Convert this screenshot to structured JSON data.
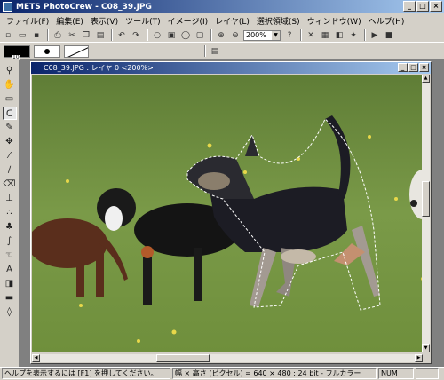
{
  "app": {
    "title": "METS PhotoCrew - C08_39.JPG"
  },
  "window_buttons": {
    "minimize": "_",
    "maximize": "□",
    "close": "×"
  },
  "menu": [
    "ファイル(F)",
    "編集(E)",
    "表示(V)",
    "ツール(T)",
    "イメージ(I)",
    "レイヤ(L)",
    "選択領域(S)",
    "ウィンドウ(W)",
    "ヘルプ(H)"
  ],
  "toolbar": {
    "zoom": "200%",
    "icons": [
      "new-file-icon",
      "open-folder-icon",
      "save-icon",
      "print-icon",
      "cut-icon",
      "copy-icon",
      "paste-icon",
      "undo-icon",
      "redo-icon",
      "zoom-in-icon",
      "zoom-out-icon",
      "help-icon",
      "play-icon",
      "stop-icon"
    ]
  },
  "options": {
    "brush_size": "10"
  },
  "tools": [
    "magnifier-icon",
    "hand-icon",
    "rect-select-icon",
    "lasso-icon",
    "magic-wand-icon",
    "move-icon",
    "eyedropper-icon",
    "brush-icon",
    "eraser-icon",
    "stamp-icon",
    "spray-icon",
    "fill-icon",
    "smudge-icon",
    "text-icon",
    "shape-icon",
    "gradient-icon",
    "clear-icon"
  ],
  "document": {
    "title": "C08_39.JPG : レイヤ 0 <200%>"
  },
  "status": {
    "help": "ヘルプを表示するには [F1] を押してください。",
    "info": "幅 × 高さ (ピクセル) = 640 × 480 : 24 bit - フルカラー",
    "num": "NUM"
  },
  "colors": {
    "titlebar_start": "#0a246a",
    "titlebar_end": "#a6caf0",
    "chrome": "#d4d0c8",
    "grass": "#6b8a3e"
  }
}
